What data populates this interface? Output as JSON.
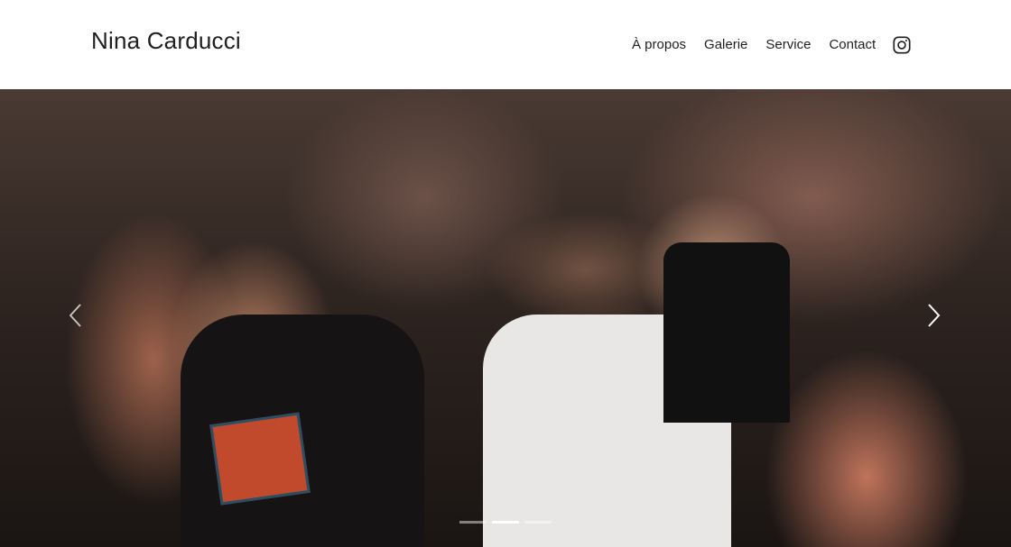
{
  "header": {
    "site_title": "Nina Carducci",
    "nav": [
      {
        "label": "À propos"
      },
      {
        "label": "Galerie"
      },
      {
        "label": "Service"
      },
      {
        "label": "Contact"
      }
    ],
    "instagram_icon": "instagram-icon"
  },
  "carousel": {
    "image_description_icon": "concert-crowd-photo",
    "prev_icon": "chevron-left-icon",
    "next_icon": "chevron-right-icon",
    "slide_count": 3,
    "active_slide": 2
  },
  "colors": {
    "text": "#1f1f1f",
    "background": "#ffffff"
  }
}
